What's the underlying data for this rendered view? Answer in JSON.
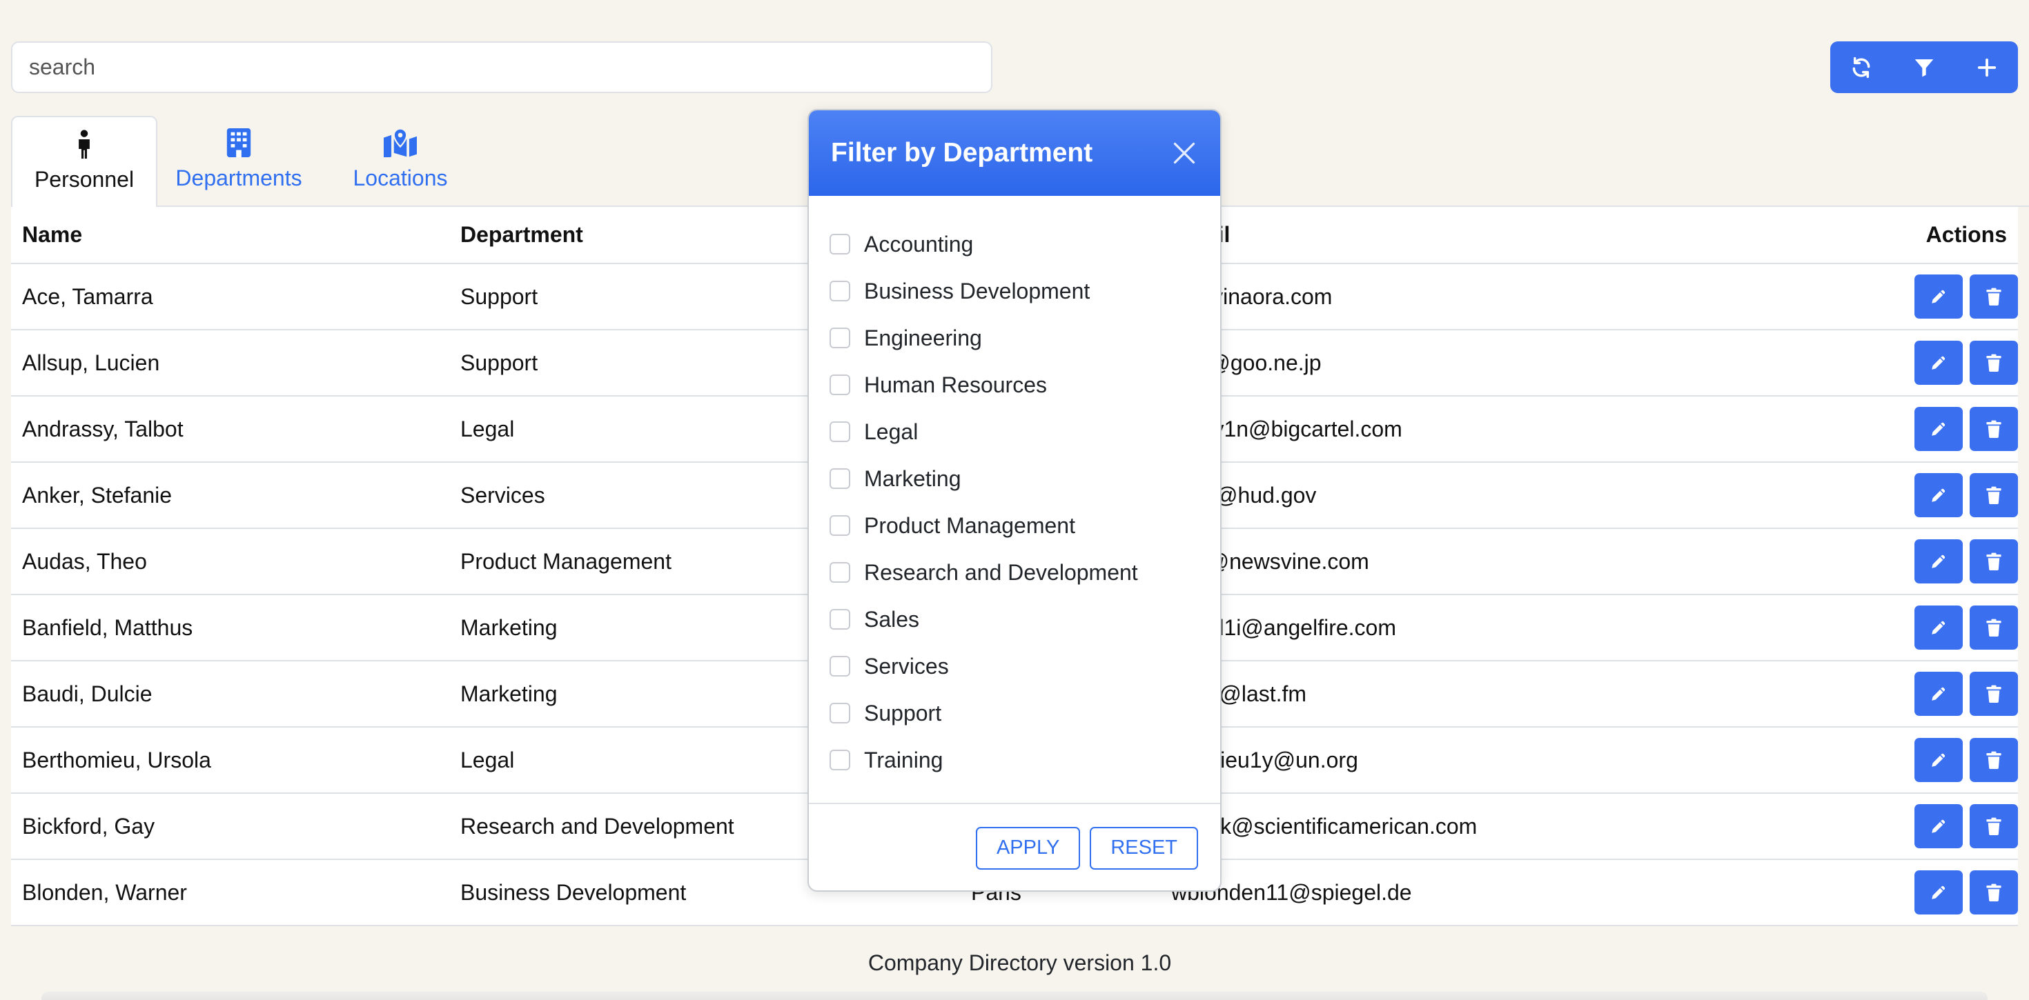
{
  "search": {
    "placeholder": "search"
  },
  "toolbar": {
    "icons": [
      "refresh-icon",
      "filter-icon",
      "plus-icon"
    ]
  },
  "tabs": [
    {
      "label": "Personnel",
      "icon": "person-icon",
      "active": true
    },
    {
      "label": "Departments",
      "icon": "building-icon",
      "active": false
    },
    {
      "label": "Locations",
      "icon": "map-icon",
      "active": false
    }
  ],
  "table": {
    "headers": [
      "Name",
      "Department",
      "",
      "Email",
      "Actions"
    ],
    "rows": [
      {
        "name": "Ace, Tamarra",
        "department": "Support",
        "location": "",
        "email": "m@vinaora.com"
      },
      {
        "name": "Allsup, Lucien",
        "department": "Support",
        "location": "",
        "email": "upo@goo.ne.jp"
      },
      {
        "name": "Andrassy, Talbot",
        "department": "Legal",
        "location": "",
        "email": "rassy1n@bigcartel.com"
      },
      {
        "name": "Anker, Stefanie",
        "department": "Services",
        "location": "",
        "email": "er2o@hud.gov"
      },
      {
        "name": "Audas, Theo",
        "department": "Product Management",
        "location": "",
        "email": "asa@newsvine.com"
      },
      {
        "name": "Banfield, Matthus",
        "department": "Marketing",
        "location": "",
        "email": "nfield1i@angelfire.com"
      },
      {
        "name": "Baudi, Dulcie",
        "department": "Marketing",
        "location": "",
        "email": "di2m@last.fm"
      },
      {
        "name": "Berthomieu, Ursola",
        "department": "Legal",
        "location": "",
        "email": "thomieu1y@un.org"
      },
      {
        "name": "Bickford, Gay",
        "department": "Research and Development",
        "location": "",
        "email": "kfordk@scientificamerican.com"
      },
      {
        "name": "Blonden, Warner",
        "department": "Business Development",
        "location": "Paris",
        "email": "wblonden11@spiegel.de"
      }
    ]
  },
  "modal": {
    "title": "Filter by Department",
    "options": [
      "Accounting",
      "Business Development",
      "Engineering",
      "Human Resources",
      "Legal",
      "Marketing",
      "Product Management",
      "Research and Development",
      "Sales",
      "Services",
      "Support",
      "Training"
    ],
    "apply_label": "APPLY",
    "reset_label": "RESET"
  },
  "footer": {
    "text": "Company Directory version 1.0"
  },
  "colors": {
    "primary": "#3a6ff0",
    "background": "#f7f4ee"
  }
}
